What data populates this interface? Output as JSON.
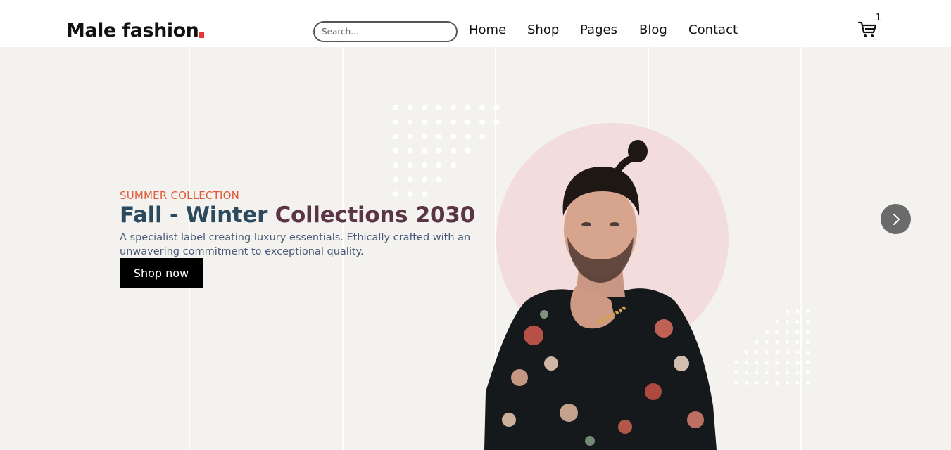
{
  "header": {
    "logo": "Male fashion",
    "search_placeholder": "Search...",
    "nav": [
      "Home",
      "Shop",
      "Pages",
      "Blog",
      "Contact"
    ],
    "cart_count": "1"
  },
  "hero": {
    "eyebrow": "SUMMER COLLECTION",
    "headline_part1": "Fall - Winter",
    "headline_part2": "Collections 2030",
    "description": "A specialist label creating luxury essentials. Ethically crafted with an unwavering commitment to exceptional quality.",
    "button_label": "Shop now"
  },
  "colors": {
    "accent": "#e53637",
    "hero_bg": "#f3f2ee",
    "circle": "#f2dcdc",
    "eyebrow": "#e05a3a",
    "headline": "#2b4a5e"
  },
  "icons": {
    "cart": "shopping-cart-icon",
    "next": "chevron-right-icon"
  }
}
